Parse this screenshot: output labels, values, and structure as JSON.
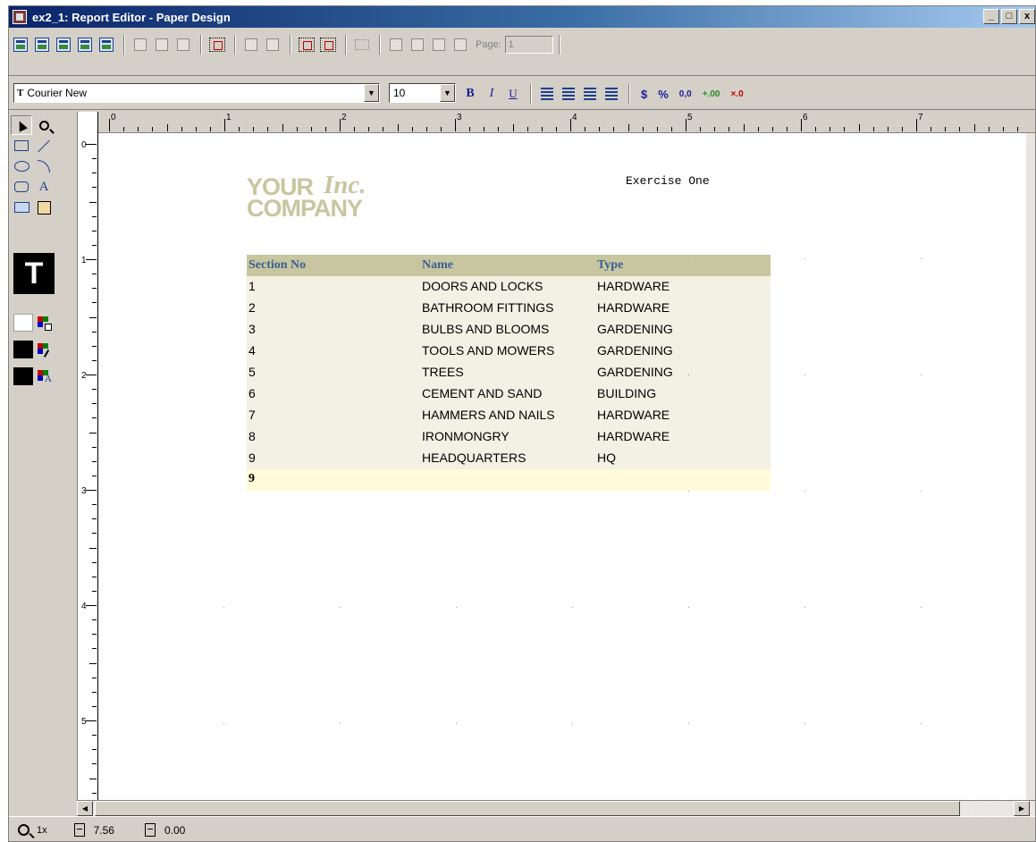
{
  "window": {
    "title": "ex2_1: Report Editor - Paper Design",
    "min_label": "_",
    "max_label": "□",
    "close_label": "x"
  },
  "toolbar": {
    "page_label": "Page:",
    "page_value": "1"
  },
  "format_bar": {
    "font_name": "Courier New",
    "font_size": "10",
    "bold_label": "B",
    "italic_label": "I",
    "underline_label": "U",
    "currency_label": "$",
    "percent_label": "%",
    "commas_label": "0,0",
    "add_decimal_label": "+.00",
    "remove_decimal_label": "×.0"
  },
  "palette": {
    "text_tool_glyph": "A",
    "current_text_glyph": "T"
  },
  "rulers": {
    "h_numbers": [
      "0",
      "1",
      "2",
      "3",
      "4",
      "5",
      "6",
      "7"
    ],
    "v_numbers": [
      "0",
      "1",
      "2",
      "3",
      "4",
      "5"
    ]
  },
  "report": {
    "logo_line1": "YOUR",
    "logo_line1b": "Inc.",
    "logo_line2": "COMPANY",
    "title": "Exercise One",
    "columns": [
      "Section No",
      "Name",
      "Type"
    ],
    "rows": [
      [
        "1",
        "DOORS AND LOCKS",
        "HARDWARE"
      ],
      [
        "2",
        "BATHROOM FITTINGS",
        "HARDWARE"
      ],
      [
        "3",
        "BULBS AND BLOOMS",
        "GARDENING"
      ],
      [
        "4",
        "TOOLS AND MOWERS",
        "GARDENING"
      ],
      [
        "5",
        "TREES",
        "GARDENING"
      ],
      [
        "6",
        "CEMENT AND SAND",
        "BUILDING"
      ],
      [
        "7",
        "HAMMERS AND NAILS",
        "HARDWARE"
      ],
      [
        "8",
        "IRONMONGRY",
        "HARDWARE"
      ],
      [
        "9",
        "HEADQUARTERS",
        "HQ"
      ]
    ],
    "summary": "9"
  },
  "status": {
    "zoom": "1x",
    "x_position": "7.56",
    "y_position": "0.00"
  },
  "colors": {
    "header_band": "#c8c6a0",
    "header_text": "#3a5f93",
    "body_band": "#f2f1e3",
    "summary_band": "#fffbd8"
  }
}
